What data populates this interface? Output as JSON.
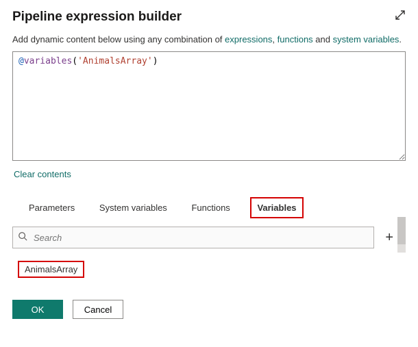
{
  "title": "Pipeline expression builder",
  "intro": {
    "prefix": "Add dynamic content below using any combination of ",
    "link1": "expressions",
    "sep1": ", ",
    "link2": "functions",
    "sep2": " and ",
    "link3": "system variables",
    "suffix": "."
  },
  "editor": {
    "at": "@",
    "fn": "variables",
    "open": "(",
    "str": "'AnimalsArray'",
    "close": ")"
  },
  "clear_label": "Clear contents",
  "tabs": {
    "t0": "Parameters",
    "t1": "System variables",
    "t2": "Functions",
    "t3": "Variables"
  },
  "search_placeholder": "Search",
  "variable_item": "AnimalsArray",
  "buttons": {
    "ok": "OK",
    "cancel": "Cancel"
  }
}
